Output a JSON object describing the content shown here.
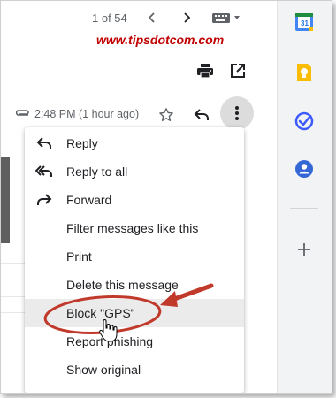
{
  "toolbar": {
    "page_count": "1 of 54",
    "time": "2:48 PM (1 hour ago)"
  },
  "watermark": "www.tipsdotcom.com",
  "menu": {
    "items": [
      {
        "label": "Reply",
        "icon": "reply-icon"
      },
      {
        "label": "Reply to all",
        "icon": "reply-all-icon"
      },
      {
        "label": "Forward",
        "icon": "forward-icon"
      },
      {
        "label": "Filter messages like this",
        "icon": ""
      },
      {
        "label": "Print",
        "icon": ""
      },
      {
        "label": "Delete this message",
        "icon": ""
      },
      {
        "label": "Block \"GPS\"",
        "icon": "",
        "highlighted": true
      },
      {
        "label": "Report phishing",
        "icon": ""
      },
      {
        "label": "Show original",
        "icon": ""
      }
    ]
  },
  "side_panel": {
    "calendar_day": "31",
    "apps": [
      "calendar-icon",
      "keep-icon",
      "tasks-icon",
      "contacts-icon",
      "add-icon"
    ]
  },
  "colors": {
    "annotation": "#c0392b",
    "calendar_blue": "#4285f4",
    "keep_yellow": "#fbbc04",
    "tasks_blue": "#3d5afe",
    "contacts_blue": "#3367d6"
  }
}
